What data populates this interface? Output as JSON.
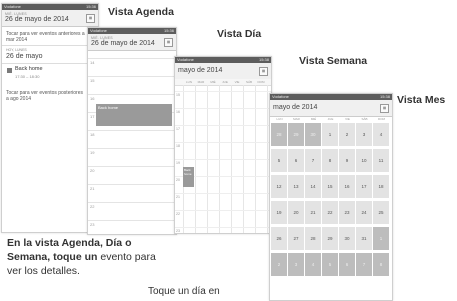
{
  "labels": {
    "agenda": "Vista Agenda",
    "dia": "Vista Día",
    "semana": "Vista Semana",
    "mes": "Vista Mes"
  },
  "status": {
    "operator": "Vodafone",
    "time": "15:36",
    "time2": "15:38"
  },
  "agenda": {
    "small_day": "MIÉ. LUNES",
    "date": "26 de mayo de 2014",
    "note_top": "Tocar para ver eventos anteriores a mar 2014",
    "section": "HOY, LUNES",
    "section_date": "26 de mayo",
    "event_title": "Back home",
    "event_time": "17:30 – 18:30",
    "note_bottom": "Tocar para ver eventos posteriores a ago 2014"
  },
  "day": {
    "small_day": "MIÉ. LUNES",
    "date": "26 de mayo de 2014",
    "hours": [
      "14",
      "15",
      "16",
      "17",
      "18",
      "19",
      "20",
      "21",
      "22",
      "23"
    ],
    "event_title": "Back home"
  },
  "week": {
    "date": "mayo de 2014",
    "days": [
      "LUN",
      "MAR",
      "MIÉ",
      "JUE",
      "VIE",
      "SÁB",
      "DOM"
    ],
    "hours": [
      "15",
      "16",
      "17",
      "18",
      "19",
      "20",
      "21",
      "22",
      "23"
    ],
    "event_title": "Back home"
  },
  "month": {
    "date": "mayo de 2014",
    "days": [
      "LUN",
      "MAR",
      "MIÉ",
      "JUE",
      "VIE",
      "SÁB",
      "DOM"
    ],
    "weeks": [
      [
        "28",
        "29",
        "30",
        "1",
        "2",
        "3",
        "4"
      ],
      [
        "5",
        "6",
        "7",
        "8",
        "9",
        "10",
        "11"
      ],
      [
        "12",
        "13",
        "14",
        "15",
        "16",
        "17",
        "18"
      ],
      [
        "19",
        "20",
        "21",
        "22",
        "23",
        "24",
        "25"
      ],
      [
        "26",
        "27",
        "28",
        "29",
        "30",
        "31",
        "1"
      ],
      [
        "2",
        "3",
        "4",
        "5",
        "6",
        "7",
        "8"
      ]
    ]
  },
  "caption": {
    "part1": "En la vista Agenda, Día o Semana, toque un",
    "part2": " evento para ver los detalles."
  },
  "footer": "Toque un día en"
}
